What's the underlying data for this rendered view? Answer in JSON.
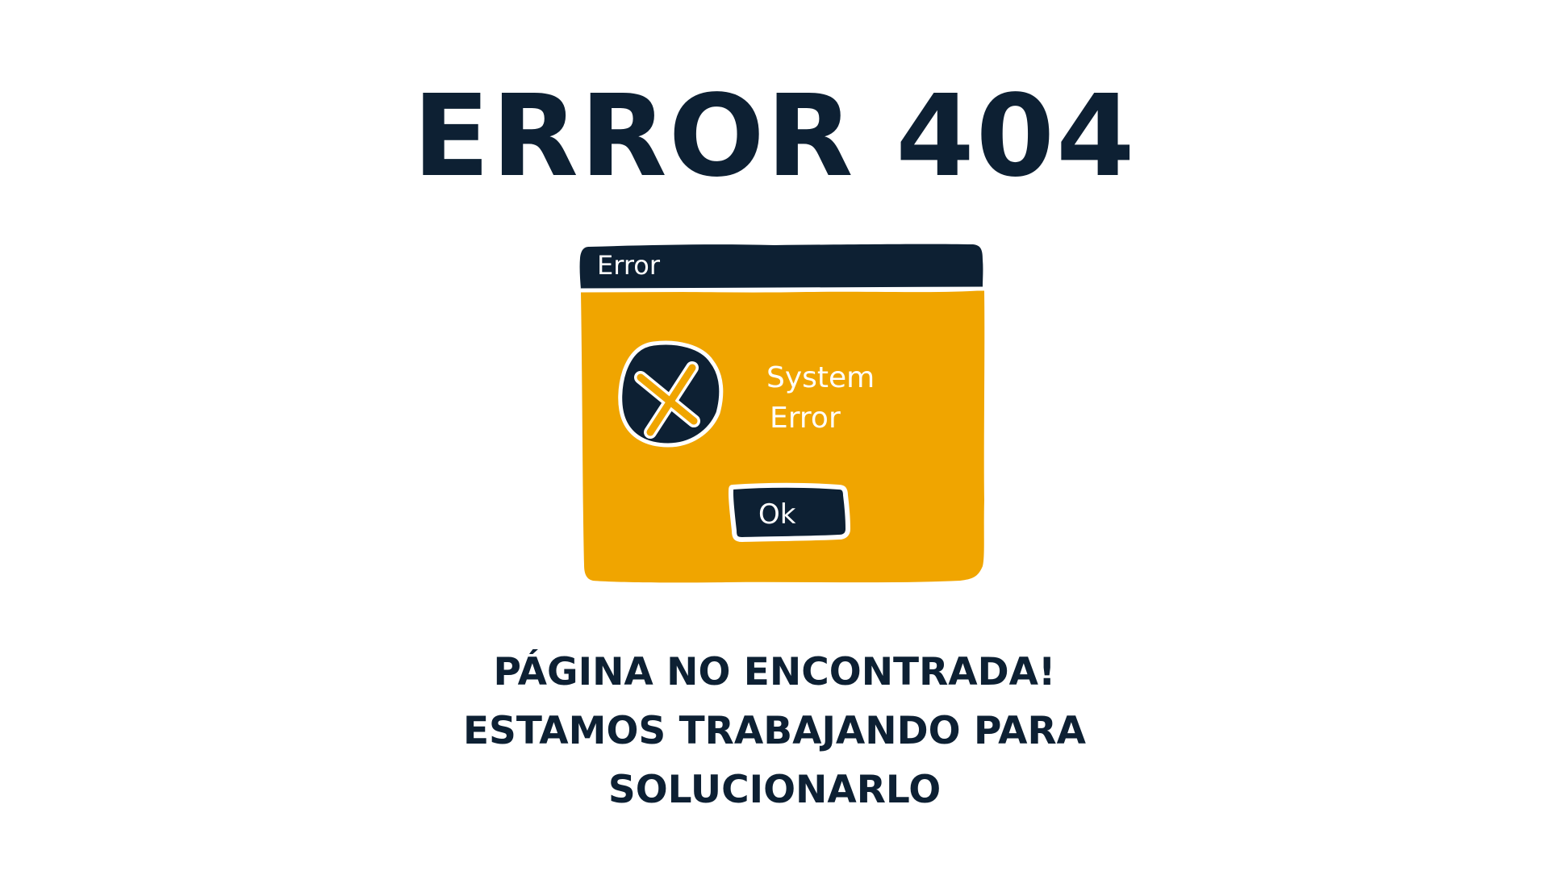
{
  "title": "ERROR 404",
  "dialog": {
    "window_title": "Error",
    "message_line1": "System",
    "message_line2": "Error",
    "ok_label": "Ok"
  },
  "message": {
    "line1": "PÁGINA NO ENCONTRADA!",
    "line2": "ESTAMOS TRABAJANDO PARA",
    "line3": "SOLUCIONARLO"
  },
  "colors": {
    "navy": "#0d2033",
    "amber": "#f0a500",
    "white": "#ffffff"
  },
  "icons": {
    "error": "x-circle-icon"
  }
}
